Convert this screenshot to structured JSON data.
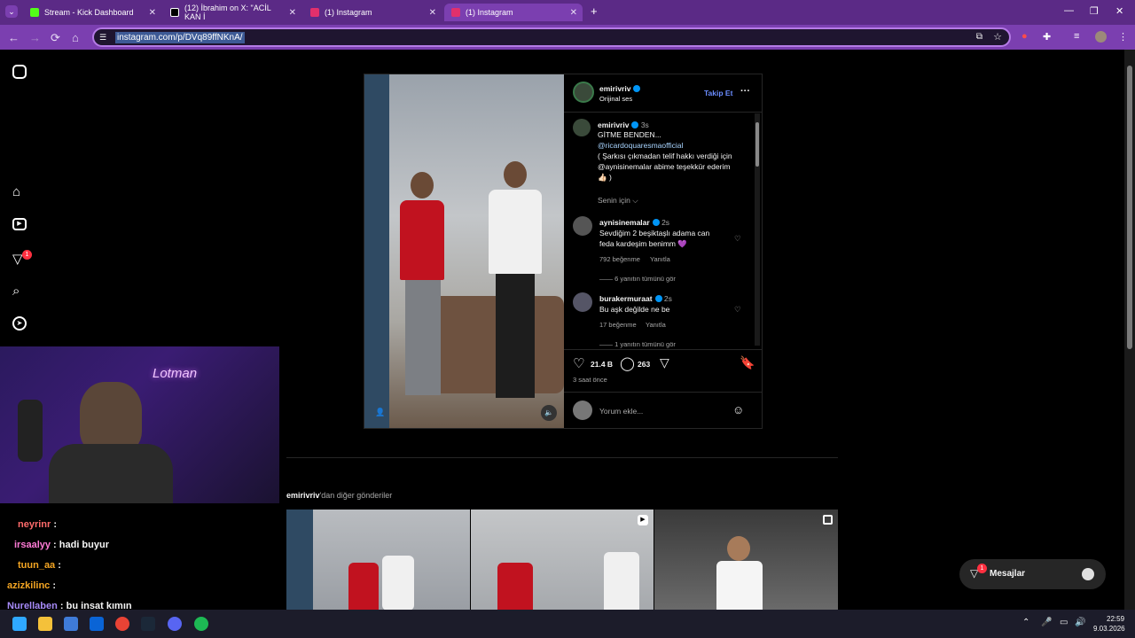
{
  "browser": {
    "tabs": [
      {
        "title": "Stream - Kick Dashboard",
        "favicon_color": "#53fc18"
      },
      {
        "title": "(12) İbrahim on X: \"ACİL KAN İ",
        "favicon_color": "#000000"
      },
      {
        "title": "(1) Instagram",
        "favicon_color": "#e1306c"
      },
      {
        "title": "(1) Instagram",
        "favicon_color": "#e1306c"
      }
    ],
    "new_tab": "+",
    "url": "instagram.com/p/DVq89ffNKnA/"
  },
  "post": {
    "username": "emirivriv",
    "subtitle": "Orijinal ses",
    "follow": "Takip Et",
    "more": "···",
    "caption_user": "emirivriv",
    "caption_time": "3s",
    "caption_lines": [
      "GİTME BENDEN...",
      "@ricardoquaresmaofficial",
      "( Şarkısı çıkmadan telif hakkı verdiği için",
      "@aynisinemalar abime teşekkür ederim",
      "👍🏻 )"
    ],
    "for_you": "Senin için ⌵",
    "comments": [
      {
        "user": "aynisinemalar",
        "time": "2s",
        "text1": "Sevdiğim 2 beşiktaşlı adama can",
        "text2": "feda kardeşim benimm 💜",
        "likes": "792 beğenme",
        "reply": "Yanıtla",
        "view": "6 yanıtın tümünü gör"
      },
      {
        "user": "burakermuraat",
        "time": "2s",
        "text1": "Bu aşk değilde ne be",
        "text2": "",
        "likes": "17 beğenme",
        "reply": "Yanıtla",
        "view": "1 yanıtın tümünü gör"
      }
    ],
    "like_count": "21.4 B",
    "comment_count": "263",
    "ago": "3 saat önce",
    "comment_placeholder": "Yorum ekle..."
  },
  "more_posts": {
    "user": "emirivriv",
    "label": "'dan diğer gönderiler"
  },
  "notifications_badge": "1",
  "messages": {
    "label": "Mesajlar",
    "badge": "1"
  },
  "chat": [
    {
      "user": "neyrinr",
      "text": " :",
      "color": "#ff6b6b"
    },
    {
      "user": "irsaalyy",
      "text": " : hadi buyur",
      "color": "#ff7bd6"
    },
    {
      "user": "tuun_aa",
      "text": " :",
      "color": "#f5a623"
    },
    {
      "user": "azizkilinc",
      "text": " :",
      "color": "#f5a623"
    },
    {
      "user": "Nurellaben",
      "text": " : bu insat kımın",
      "color": "#a78bfa"
    }
  ],
  "stream_overlay": "Lotman",
  "clock": {
    "time": "22:59",
    "date": "9.03.2026"
  }
}
